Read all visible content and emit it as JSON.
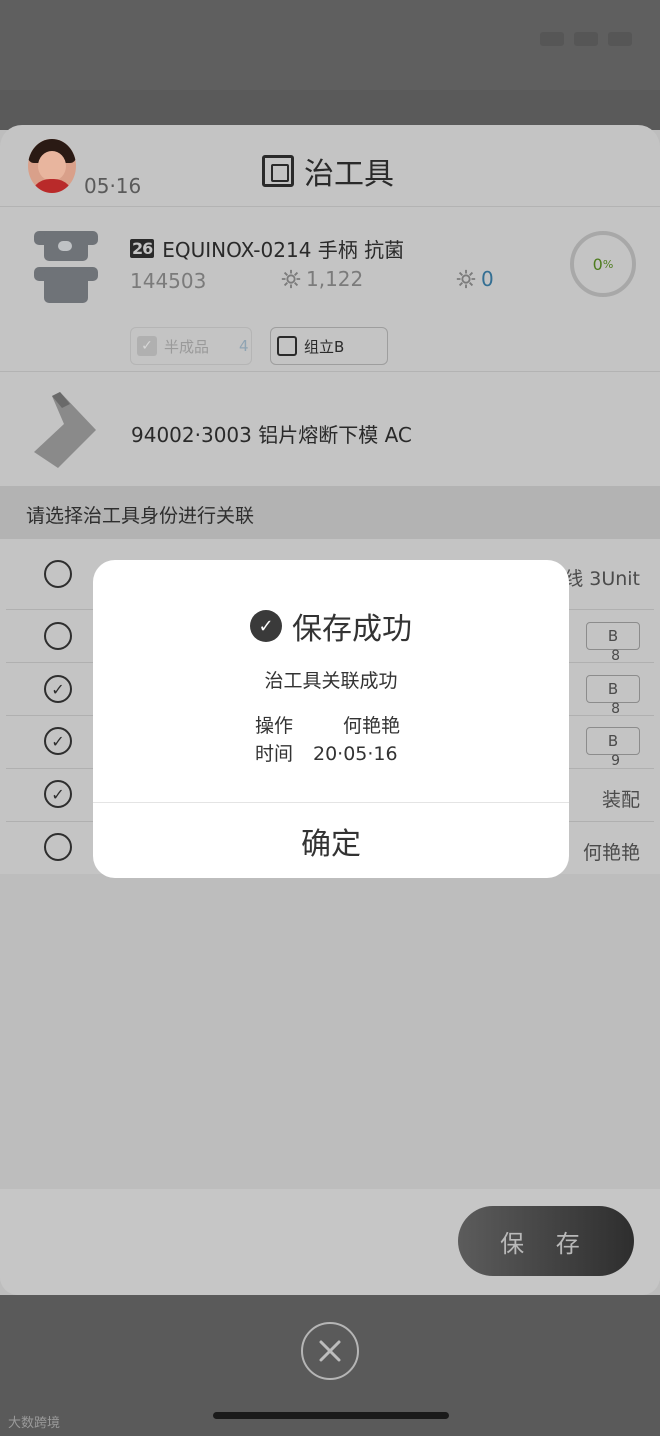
{
  "header": {
    "date": "05·16",
    "title": "治工具"
  },
  "tool": {
    "badge": "26",
    "name": "EQUINOX-0214 手柄 抗菌",
    "code": "144503",
    "gear_count_1": "1,122",
    "gear_count_2": "0",
    "progress": "0",
    "progress_unit": "%",
    "chips": {
      "chip1_label": "半成品",
      "chip1_count": "4",
      "chip2_label": "组立B"
    }
  },
  "mold": {
    "label": "94002·3003 铝片熔断下模 AC"
  },
  "prompt": "请选择治工具身份进行关联",
  "rows": [
    {
      "checked": false,
      "right": "线 3Unit"
    },
    {
      "checked": false,
      "badge": "B",
      "num": "8"
    },
    {
      "checked": true,
      "badge": "B",
      "num": "8"
    },
    {
      "checked": true,
      "badge": "B",
      "num": "9"
    },
    {
      "checked": true,
      "right": "装配"
    },
    {
      "checked": false,
      "right": "何艳艳"
    }
  ],
  "footer": {
    "save_label": "保 存"
  },
  "dialog": {
    "title": "保存成功",
    "message": "治工具关联成功",
    "op_label": "操作",
    "op_value": "何艳艳",
    "time_label": "时间",
    "time_value": "20·05·16",
    "ok_label": "确定"
  },
  "watermark": "大数跨境"
}
